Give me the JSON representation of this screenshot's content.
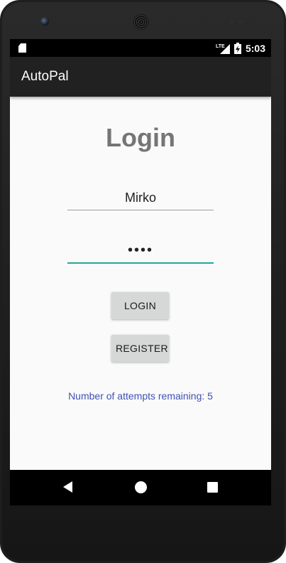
{
  "status_bar": {
    "time": "5:03",
    "network_label": "LTE",
    "icons": [
      "sd-card-icon",
      "lte-signal-icon",
      "battery-charging-icon"
    ]
  },
  "app_bar": {
    "title": "AutoPal"
  },
  "login_form": {
    "heading": "Login",
    "username_value": "Mirko",
    "password_value": "••••",
    "login_button_label": "LOGIN",
    "register_button_label": "REGISTER",
    "attempts_text": "Number of attempts remaining: 5"
  },
  "nav_bar": {
    "icons": [
      "back-icon",
      "home-icon",
      "recents-icon"
    ]
  },
  "colors": {
    "app_bar_bg": "#212121",
    "screen_bg": "#fafafa",
    "heading": "#757575",
    "accent_underline": "#26a69a",
    "attempts_text": "#3f51b5",
    "button_bg": "#d6d7d7"
  }
}
